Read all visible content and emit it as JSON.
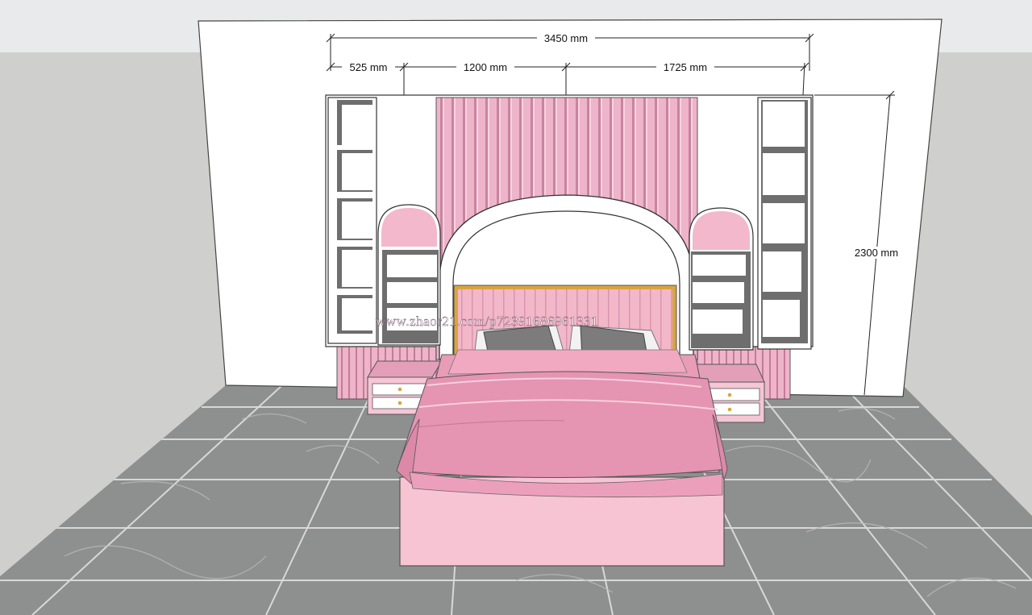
{
  "dimensions": {
    "total_width": "3450 mm",
    "left_section": "525 mm",
    "middle_section": "1200 mm",
    "right_section": "1725 mm",
    "height": "2300 mm"
  },
  "watermark": "www.zhaor21.com/p72391686961331",
  "colors": {
    "sky": "#e8eaeb",
    "ground": "#cfd0cd",
    "wall": "#ffffff",
    "pink_panel": "#e9a7bf",
    "pink_dark": "#cf7f9f",
    "bed_pink": "#f2b6c8",
    "floor_tile": "#8f9090",
    "shelf_gray": "#6e6e6e",
    "gold": "#d9a441"
  }
}
